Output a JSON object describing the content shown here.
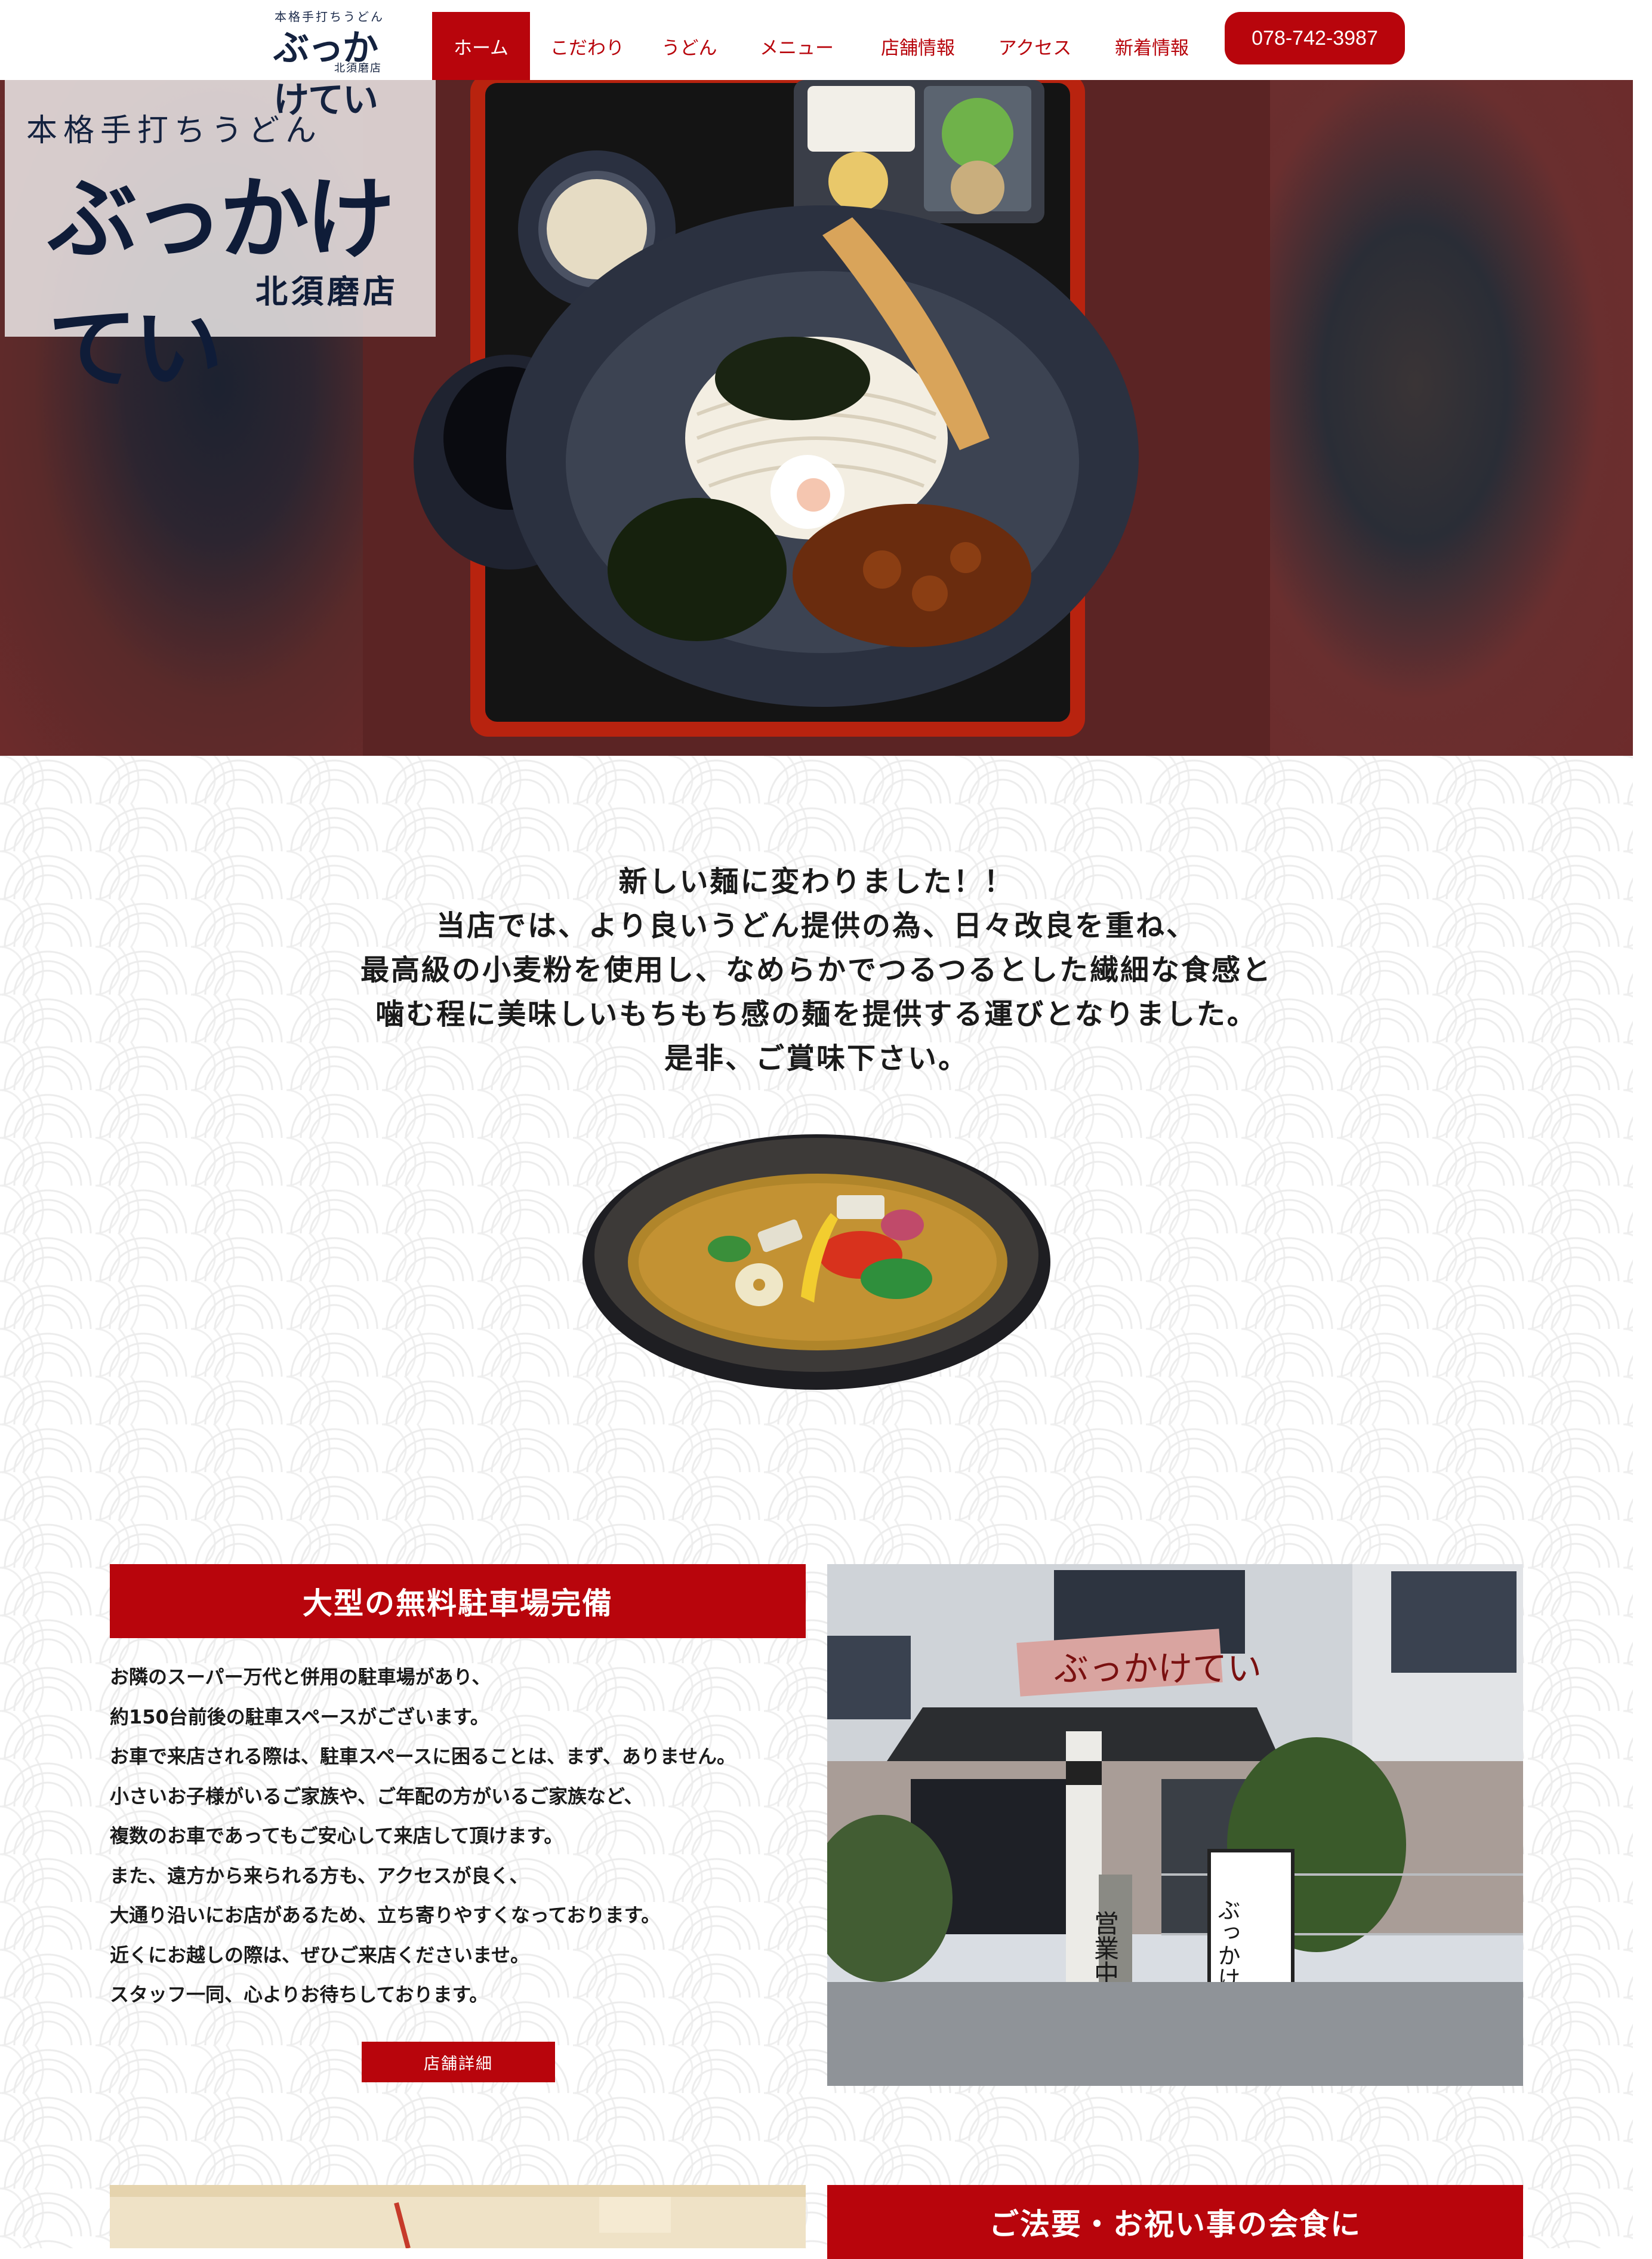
{
  "header": {
    "logo": {
      "small": "本格手打ちうどん",
      "name": "ぶっかけてい",
      "branch": "北須磨店"
    },
    "nav": [
      {
        "label": "ホーム",
        "active": true
      },
      {
        "label": "こだわり"
      },
      {
        "label": "うどん"
      },
      {
        "label": "メニュー"
      },
      {
        "label": "店舗情報"
      },
      {
        "label": "アクセス"
      },
      {
        "label": "新着情報"
      }
    ],
    "phone": "078-742-3987"
  },
  "hero": {
    "subtitle": "本格手打ちうどん",
    "name": "ぶっかけてい",
    "branch": "北須磨店"
  },
  "intro": {
    "lines": [
      "新しい麺に変わりました！！",
      "当店では、より良いうどん提供の為、日々改良を重ね、",
      "最高級の小麦粉を使用し、なめらかでつるつるとした繊細な食感と",
      "噛む程に美味しいもちもち感の麺を提供する運びとなりました。",
      "是非、ご賞味下さい。"
    ]
  },
  "parking": {
    "heading": "大型の無料駐車場完備",
    "paragraphs": [
      "お隣のスーパー万代と併用の駐車場があり、",
      "約150台前後の駐車スペースがございます。",
      "お車で来店される際は、駐車スペースに困ることは、まず、ありません。",
      "小さいお子様がいるご家族や、ご年配の方がいるご家族など、",
      "複数のお車であってもご安心して来店して頂けます。",
      "また、遠方から来られる方も、アクセスが良く、",
      "大通り沿いにお店があるため、立ち寄りやすくなっております。",
      "近くにお越しの際は、ぜひご来店くださいませ。",
      "スタッフ一同、心よりお待ちしております。"
    ],
    "button": "店舗詳細",
    "sign_text": "ぶっかけてい",
    "banner_text": "営業中"
  },
  "celebration": {
    "heading": "ご法要・お祝い事の会食に"
  },
  "colors": {
    "brand_red": "#b8050c",
    "brand_navy": "#14223f"
  }
}
